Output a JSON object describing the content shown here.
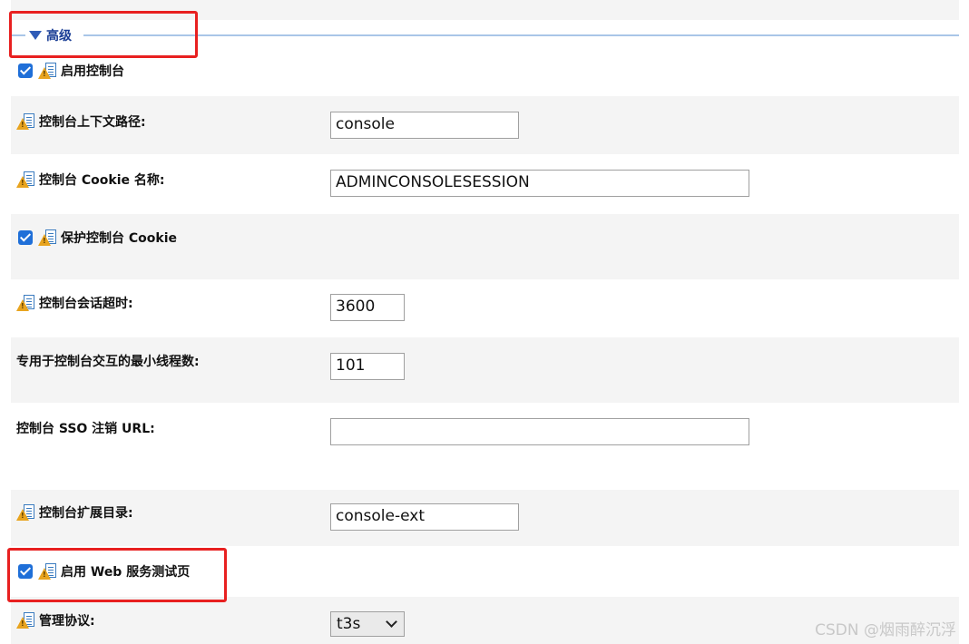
{
  "section": {
    "title": "高级"
  },
  "rows": [
    {
      "id": "enable_console",
      "label": "启用控制台",
      "checkbox": true
    },
    {
      "id": "context_path",
      "label": "控制台上下文路径:",
      "value": "console"
    },
    {
      "id": "cookie_name",
      "label": "控制台 Cookie 名称:",
      "value": "ADMINCONSOLESESSION"
    },
    {
      "id": "protect_cookie",
      "label": "保护控制台 Cookie",
      "checkbox": true
    },
    {
      "id": "session_timeout",
      "label": "控制台会话超时:",
      "value": "3600"
    },
    {
      "id": "min_threads",
      "label": "专用于控制台交互的最小线程数:",
      "value": "101"
    },
    {
      "id": "sso_url",
      "label": "控制台 SSO 注销 URL:",
      "value": ""
    },
    {
      "id": "ext_dir",
      "label": "控制台扩展目录:",
      "value": "console-ext"
    },
    {
      "id": "enable_ws_test",
      "label": "启用 Web 服务测试页",
      "checkbox": true
    },
    {
      "id": "admin_protocol",
      "label": "管理协议:",
      "value": "t3s"
    }
  ],
  "watermark": "CSDN @烟雨醉沉浮",
  "colors": {
    "row_shade": "#f4f4f4",
    "section_title": "#1a3e96",
    "checkbox": "#1f6fd8",
    "highlight_box": "#e82020"
  }
}
